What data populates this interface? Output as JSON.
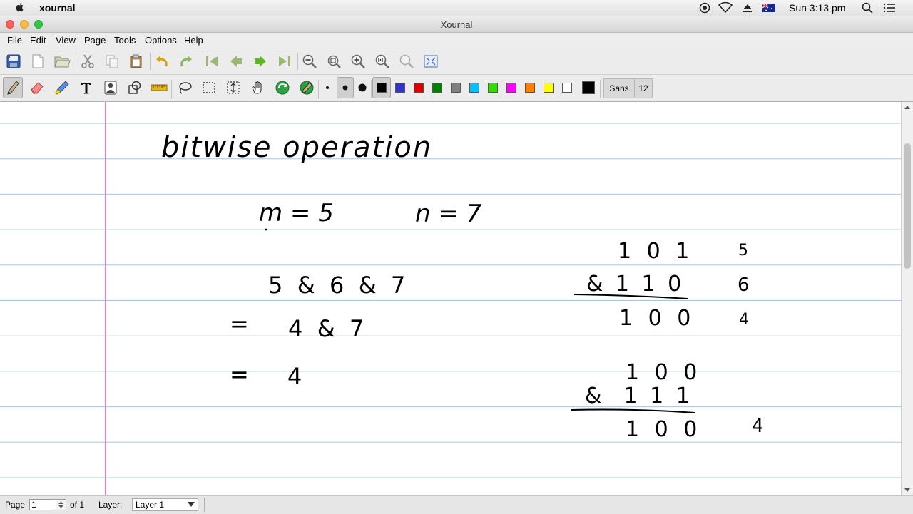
{
  "mac_menubar": {
    "app_name": "xournal",
    "clock": "Sun 3:13 pm",
    "icons": [
      "apple-icon",
      "screen-record-icon",
      "wifi-icon",
      "eject-icon",
      "flag-icon",
      "search-icon",
      "list-icon"
    ]
  },
  "window": {
    "title": "Xournal"
  },
  "menu": {
    "file": "File",
    "edit": "Edit",
    "view": "View",
    "page": "Page",
    "tools": "Tools",
    "options": "Options",
    "help": "Help"
  },
  "toolbar1": {
    "icons": [
      "save-icon",
      "new-icon",
      "open-icon",
      "cut-icon",
      "copy-icon",
      "paste-icon",
      "undo-icon",
      "redo-icon",
      "first-page-icon",
      "prev-page-icon",
      "next-page-icon",
      "last-page-icon",
      "zoom-out-icon",
      "zoom-fit-icon",
      "zoom-in-icon",
      "zoom-100-icon",
      "zoom-select-icon",
      "fullscreen-icon"
    ]
  },
  "toolbar2": {
    "font_name": "Sans",
    "font_size": "12",
    "colors": {
      "black": "#000000",
      "blue": "#3333cc",
      "red": "#dd0000",
      "green": "#008000",
      "gray": "#808080",
      "lightblue": "#00c0ff",
      "lightgreen": "#33dd00",
      "magenta": "#ff00ff",
      "orange": "#ff8000",
      "yellow": "#ffff00",
      "white": "#ffffff"
    }
  },
  "page": {
    "title": "bitwise operation",
    "m_def": "m = 5",
    "n_def": "n = 7",
    "expr1": "5  &  6  &  7",
    "eq1": "=",
    "expr2": "4  &  7",
    "eq2": "=",
    "result": "4",
    "calc1": {
      "row1": "1 0 1",
      "row1_val": "5",
      "row2": "& 1 1 0",
      "row2_val": "6",
      "row3": "1 0 0",
      "row3_val": "4"
    },
    "calc2": {
      "row1": "1 0 0",
      "row2": "&  1 1 1",
      "row3": "1 0 0",
      "row3_val": "4"
    },
    "colors": {
      "ruling": "#9fc8ee",
      "margin": "#d8338a",
      "ink": "#000000"
    }
  },
  "status": {
    "page_label": "Page",
    "page_value": "1",
    "of_label": "of 1",
    "layer_label": "Layer:",
    "layer_value": "Layer 1"
  }
}
